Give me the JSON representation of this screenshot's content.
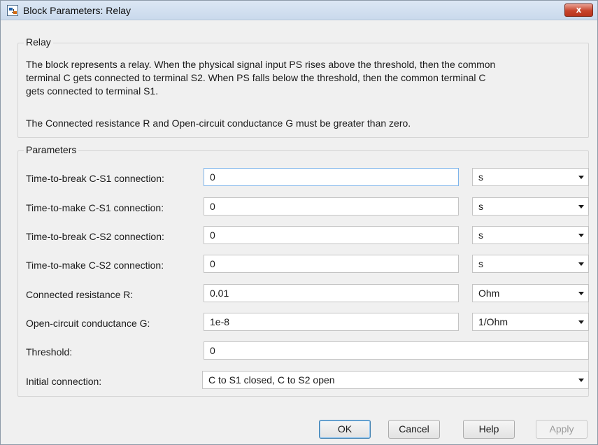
{
  "window": {
    "title": "Block Parameters: Relay",
    "close_label": "x"
  },
  "relay": {
    "group_title": "Relay",
    "description_lines": [
      "The block represents a relay. When the physical signal input PS rises above the threshold, then the common",
      "terminal C gets connected to terminal S2. When PS falls below the threshold, then the common terminal C",
      "gets connected to terminal S1."
    ],
    "note": "The Connected resistance R and Open-circuit conductance G must be greater than zero."
  },
  "parameters": {
    "group_title": "Parameters",
    "rows": [
      {
        "label": "Time-to-break C-S1 connection:",
        "value": "0",
        "unit": "s"
      },
      {
        "label": "Time-to-make C-S1 connection:",
        "value": "0",
        "unit": "s"
      },
      {
        "label": "Time-to-break C-S2 connection:",
        "value": "0",
        "unit": "s"
      },
      {
        "label": "Time-to-make C-S2 connection:",
        "value": "0",
        "unit": "s"
      },
      {
        "label": "Connected resistance R:",
        "value": "0.01",
        "unit": "Ohm"
      },
      {
        "label": "Open-circuit conductance G:",
        "value": "1e-8",
        "unit": "1/Ohm"
      }
    ],
    "threshold": {
      "label": "Threshold:",
      "value": "0"
    },
    "initial_connection": {
      "label": "Initial connection:",
      "value": "C to S1 closed, C to S2 open"
    }
  },
  "buttons": {
    "ok": "OK",
    "cancel": "Cancel",
    "help": "Help",
    "apply": "Apply"
  },
  "colors": {
    "accent_focus": "#7eb4ea",
    "close_button": "#c7442c",
    "window_bg": "#f0f0f0"
  }
}
